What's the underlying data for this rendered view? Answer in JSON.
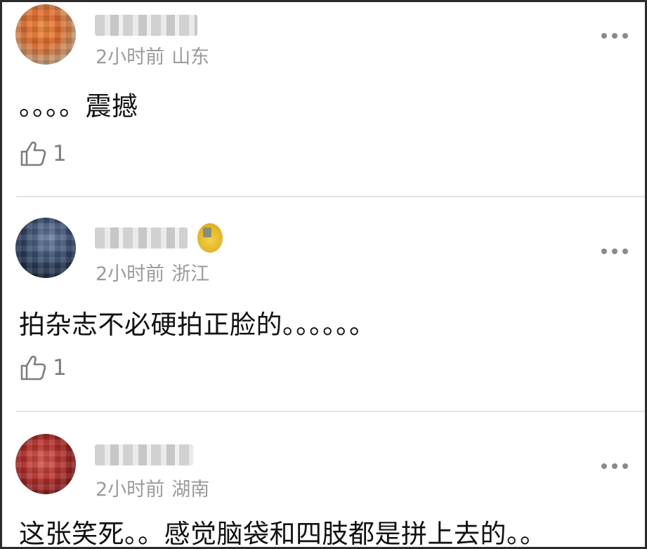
{
  "comments": [
    {
      "time": "2小时前",
      "location": "山东",
      "text": "。。。。震撼",
      "likes": "1",
      "has_badge": false
    },
    {
      "time": "2小时前",
      "location": "浙江",
      "text": "拍杂志不必硬拍正脸的。。。。。。",
      "likes": "1",
      "has_badge": true
    },
    {
      "time": "2小时前",
      "location": "湖南",
      "text": "这张笑死。。感觉脑袋和四肢都是拼上去的。。",
      "likes": null,
      "has_badge": false
    }
  ],
  "icons": {
    "more": "more-dots-icon",
    "like": "thumbs-up-icon"
  },
  "colors": {
    "meta_text": "#9b9b9b",
    "divider": "#e3e3e3",
    "badge": "#e2b62a"
  }
}
